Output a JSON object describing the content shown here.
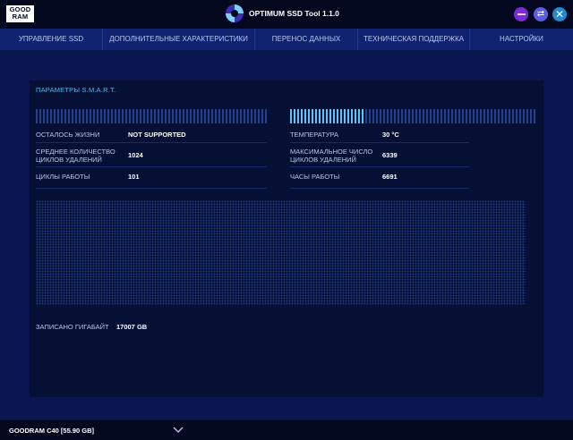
{
  "titlebar": {
    "logo_line1": "GOOD",
    "logo_line2": "RAM",
    "app_title": "OPTIMUM SSD Tool 1.1.0"
  },
  "nav": {
    "items": [
      {
        "label": "УПРАВЛЕНИЕ SSD"
      },
      {
        "label": "ДОПОЛНИТЕЛЬНЫЕ ХАРАКТЕРИСТИКИ"
      },
      {
        "label": "ПЕРЕНОС ДАННЫХ"
      },
      {
        "label": "ТЕХНИЧЕСКАЯ ПОДДЕРЖКА"
      },
      {
        "label": "НАСТРОЙКИ"
      }
    ]
  },
  "smart": {
    "title": "ПАРАМЕТРЫ S.M.A.R.T.",
    "life_label": "ОСТАЛОСЬ ЖИЗНИ",
    "life_value": "NOT SUPPORTED",
    "avg_erase_label": "СРЕДНЕЕ КОЛИЧЕСТВО ЦИКЛОВ УДАЛЕНИЙ",
    "avg_erase_value": "1024",
    "power_cycles_label": "ЦИКЛЫ РАБОТЫ",
    "power_cycles_value": "101",
    "temp_label": "ТЕМПЕРАТУРА",
    "temp_value": "30 °C",
    "max_erase_label": "МАКСИМАЛЬНОЕ ЧИСЛО ЦИКЛОВ УДАЛЕНИЙ",
    "max_erase_value": "6339",
    "hours_label": "ЧАСЫ РАБОТЫ",
    "hours_value": "6691",
    "written_label": "ЗАПИСАНО ГИГАБАЙТ",
    "written_value": "17007 GB"
  },
  "drive": {
    "selected": "GOODRAM C40 [55.90 GB]"
  },
  "colors": {
    "accent": "#5ec6f5",
    "background": "#0b1650",
    "panel": "#061035"
  }
}
